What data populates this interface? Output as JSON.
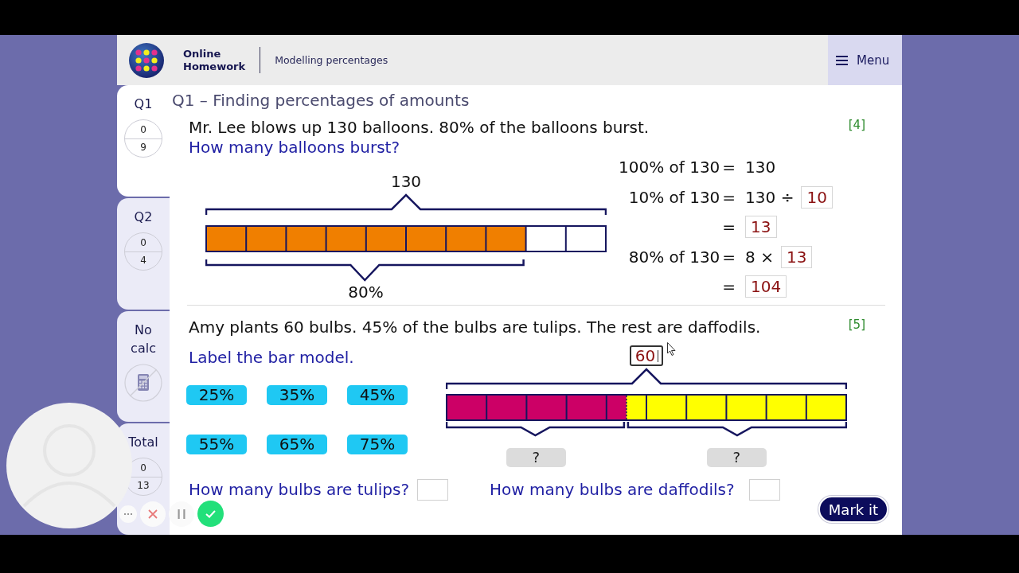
{
  "header": {
    "app_name": "Online Homework",
    "topic": "Modelling percentages",
    "menu": {
      "label": "Menu"
    }
  },
  "sidebar": {
    "questions": [
      {
        "label": "Q1",
        "selected": true,
        "score": "0",
        "out_of": "9"
      },
      {
        "label": "Q2",
        "selected": false,
        "score": "0",
        "out_of": "4"
      }
    ],
    "calculator": {
      "label": "No calc",
      "allowed": false
    },
    "total": {
      "label": "Total",
      "score": "0",
      "out_of": "13"
    }
  },
  "title": "Q1 – Finding percentages of amounts",
  "questions": [
    {
      "kind": "working",
      "statement": "Mr. Lee blows up 130 balloons. 80% of the balloons burst.",
      "prompt": "How many balloons burst?",
      "marks": "[4]",
      "bar_model": {
        "top": {
          "kind": "text",
          "text": "130"
        },
        "segments": [
          {
            "color": "#f07f00",
            "level": 0.8,
            "label": {
              "kind": "text",
              "text": "80%"
            }
          }
        ]
      },
      "working": [
        {
          "left": "100% of 130",
          "sign": "=",
          "parts": [
            {
              "kind": "text",
              "text": "130"
            }
          ]
        },
        {
          "left": "10% of 130",
          "sign": "=",
          "parts": [
            {
              "kind": "text",
              "text": "130 ÷"
            },
            {
              "kind": "answer",
              "text": "10"
            }
          ]
        },
        {
          "sign": "=",
          "parts": [
            {
              "kind": "answer",
              "text": "13"
            }
          ]
        },
        {
          "left": "80% of 130",
          "sign": "=",
          "parts": [
            {
              "kind": "text",
              "text": "8 ×"
            },
            {
              "kind": "answer",
              "text": "13"
            }
          ]
        },
        {
          "sign": "=",
          "parts": [
            {
              "kind": "answer",
              "text": "104"
            }
          ]
        }
      ]
    },
    {
      "kind": "labelling",
      "statement": "Amy plants 60 bulbs. 45% of the bulbs are tulips. The rest are daffodils.",
      "marks": "[5]",
      "prompt": "Label the bar model.",
      "tiles": [
        "25%",
        "35%",
        "45%",
        "55%",
        "65%",
        "75%"
      ],
      "bar_model": {
        "top": {
          "kind": "answer",
          "text": "60",
          "focused": true
        },
        "segments": [
          {
            "color": "#cc0066",
            "level": 0.45,
            "label": {
              "kind": "drop-zone",
              "text": "?"
            }
          },
          {
            "color": "#ffff00",
            "level": 0.55,
            "label": {
              "kind": "drop-zone",
              "text": "?"
            }
          }
        ]
      },
      "answers": [
        {
          "label": "How many bulbs are tulips?"
        },
        {
          "label": "How many bulbs are daffodils?"
        }
      ]
    }
  ],
  "mark_button": "Mark it",
  "recorder": {
    "controls": [
      {
        "kind": "more"
      },
      {
        "kind": "discard"
      },
      {
        "kind": "pause"
      },
      {
        "kind": "finish"
      }
    ]
  }
}
